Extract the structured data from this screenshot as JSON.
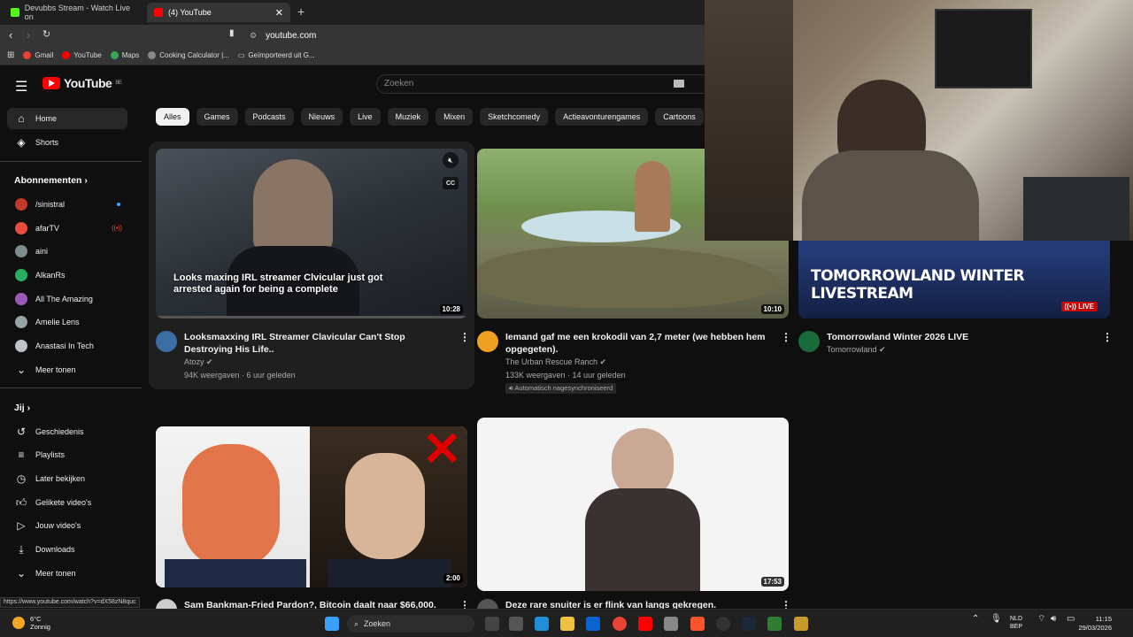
{
  "browser": {
    "tabs": [
      {
        "label": "Devubbs Stream - Watch Live on"
      },
      {
        "label": "(4) YouTube"
      }
    ],
    "url": "youtube.com",
    "bookmarks": [
      "Gmail",
      "YouTube",
      "Maps",
      "Cooking Calculator |...",
      "Geïmporteerd uit G..."
    ]
  },
  "youtube": {
    "logo_text": "YouTube",
    "logo_region": "BE",
    "search_placeholder": "Zoeken",
    "chips": [
      "Alles",
      "Games",
      "Podcasts",
      "Nieuws",
      "Live",
      "Muziek",
      "Mixen",
      "Sketchcomedy",
      "Actieavonturengames",
      "Cartoons"
    ],
    "sidebar": {
      "main": [
        {
          "label": "Home"
        },
        {
          "label": "Shorts"
        }
      ],
      "subs_heading": "Abonnementen",
      "subscriptions": [
        {
          "label": "/sinistral",
          "color": "#c0392b"
        },
        {
          "label": "afarTV",
          "color": "#e74c3c"
        },
        {
          "label": "aini",
          "color": "#7f8c8d"
        },
        {
          "label": "AlkanRs",
          "color": "#27ae60"
        },
        {
          "label": "All The Amazing",
          "color": "#9b59b6"
        },
        {
          "label": "Amelie Lens",
          "color": "#95a5a6"
        },
        {
          "label": "Anastasi In Tech",
          "color": "#bdc3c7"
        }
      ],
      "show_more": "Meer tonen",
      "you_heading": "Jij",
      "you_items": [
        {
          "label": "Geschiedenis"
        },
        {
          "label": "Playlists"
        },
        {
          "label": "Later bekijken"
        },
        {
          "label": "Gelikete video's"
        },
        {
          "label": "Jouw video's"
        },
        {
          "label": "Downloads"
        }
      ],
      "show_more_2": "Meer tonen"
    },
    "videos": [
      {
        "title": "Looksmaxxing IRL Streamer Clavicular Can't Stop Destroying His Life..",
        "channel": "Atozy",
        "meta": "94K weergaven · 6 uur geleden",
        "duration": "10:28",
        "overlay": "Looks maxing IRL streamer Clvicular just got arrested again for being a complete",
        "cc": "CC"
      },
      {
        "title": "Iemand gaf me een krokodil van 2,7 meter (we hebben hem opgegeten).",
        "channel": "The Urban Rescue Ranch",
        "meta": "133K weergaven · 14 uur geleden",
        "tag": "Automatisch nagesynchroniseerd",
        "duration": "10:10"
      },
      {
        "title": "Tomorrowland Winter 2026 LIVE",
        "channel": "Tomorrowland",
        "badge": "LIVE",
        "thumb_text_1": "TOMORROWLAND WINTER",
        "thumb_text_2": "LIVESTREAM"
      },
      {
        "title": "Sam Bankman-Fried Pardon?, Bitcoin daalt naar $66,000.",
        "duration": "2:00"
      },
      {
        "title": "Deze rare snuiter is er flink van langs gekregen.",
        "duration": "17:53"
      }
    ]
  },
  "status_url": "https://www.youtube.com/watch?v=dX58zN8quc",
  "taskbar": {
    "weather_temp": "6°C",
    "weather_desc": "Zonnig",
    "search": "Zoeken",
    "lang_1": "NLD",
    "lang_2": "BEP",
    "time": "11:15",
    "date": "29/03/2026"
  }
}
